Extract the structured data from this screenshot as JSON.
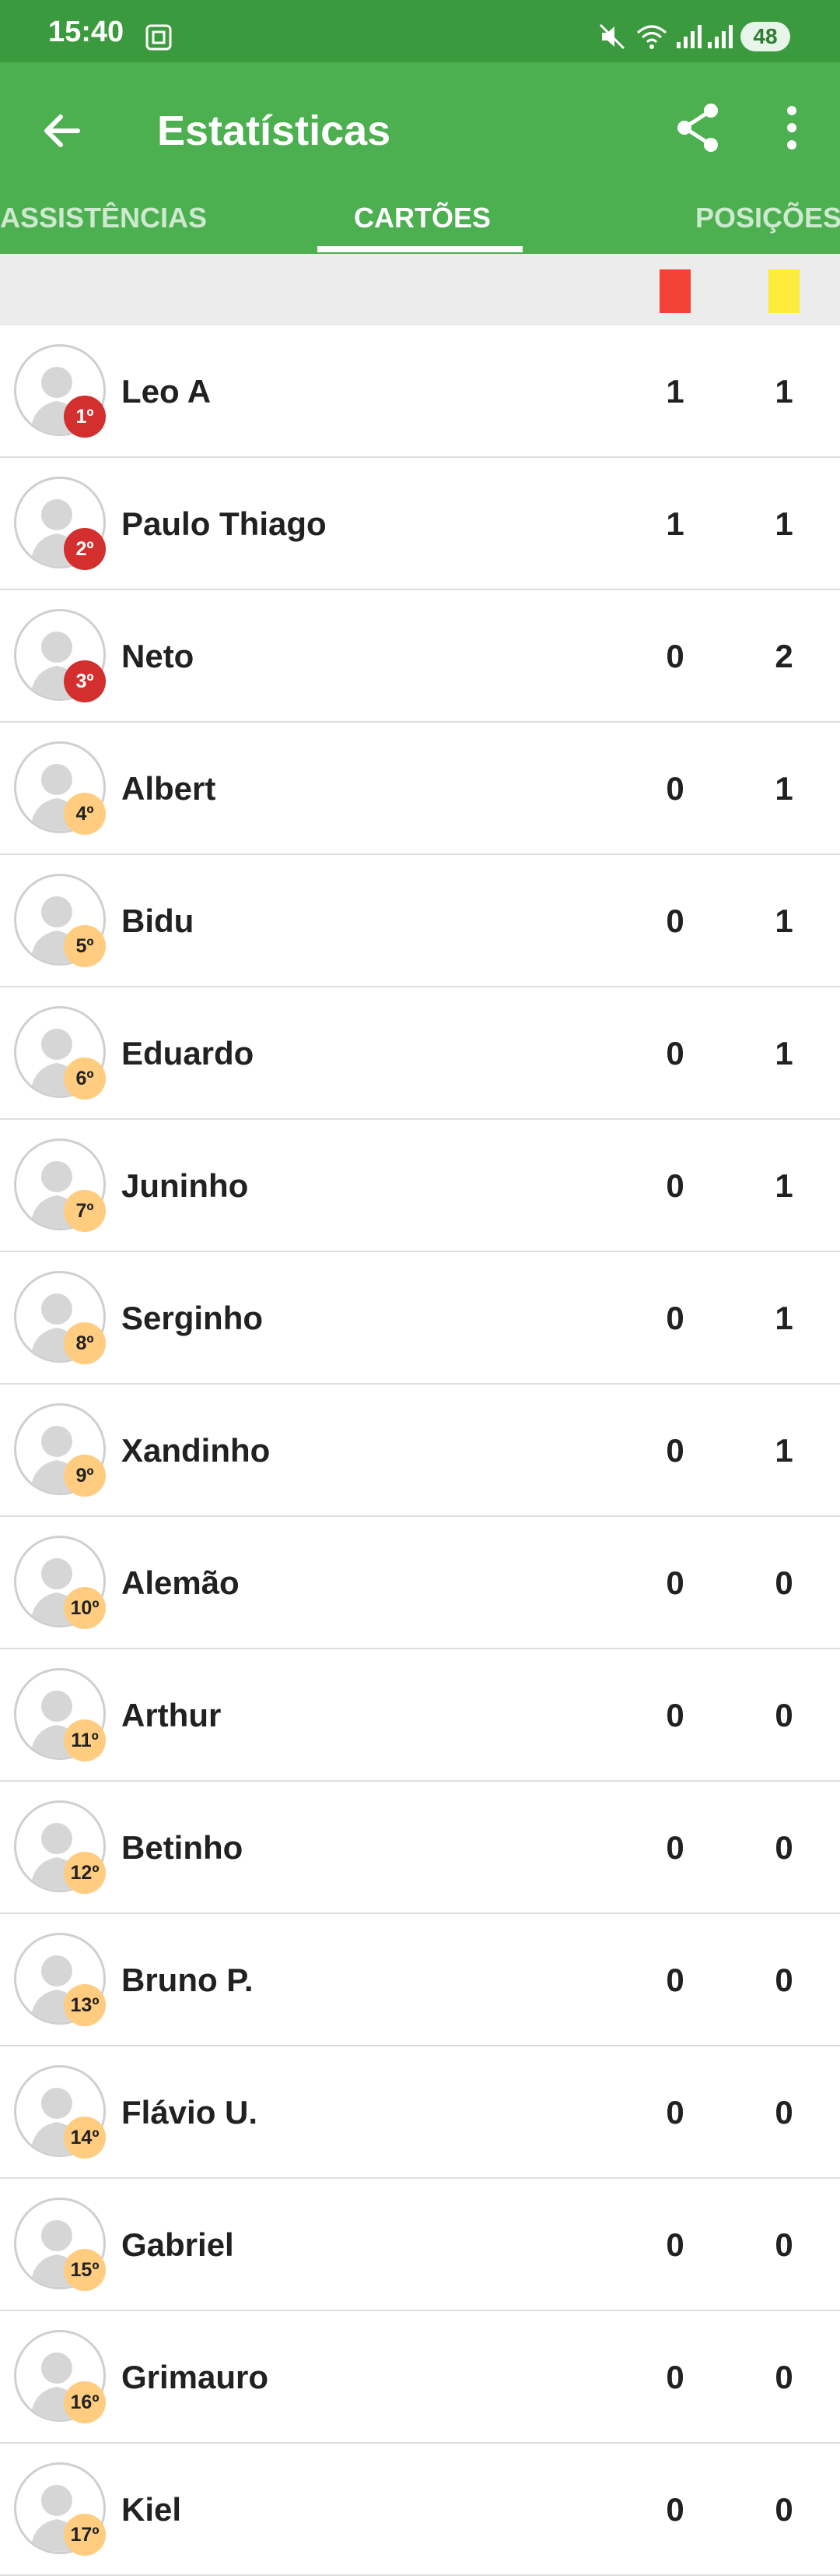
{
  "status_bar": {
    "time": "15:40",
    "battery": "48"
  },
  "app_bar": {
    "title": "Estatísticas"
  },
  "tabs": [
    {
      "label": "ASSISTÊNCIAS",
      "selected": false
    },
    {
      "label": "CARTÕES",
      "selected": true
    },
    {
      "label": "POSIÇÕES",
      "selected": false
    }
  ],
  "colors": {
    "red_card": "#f44336",
    "yellow_card": "#ffeb3b",
    "app_green": "#4caf50",
    "status_green": "#3b9a3e"
  },
  "players": [
    {
      "rank": "1º",
      "name": "Leo A",
      "red": "1",
      "yellow": "1"
    },
    {
      "rank": "2º",
      "name": "Paulo Thiago",
      "red": "1",
      "yellow": "1"
    },
    {
      "rank": "3º",
      "name": "Neto",
      "red": "0",
      "yellow": "2"
    },
    {
      "rank": "4º",
      "name": "Albert",
      "red": "0",
      "yellow": "1"
    },
    {
      "rank": "5º",
      "name": "Bidu",
      "red": "0",
      "yellow": "1"
    },
    {
      "rank": "6º",
      "name": "Eduardo",
      "red": "0",
      "yellow": "1"
    },
    {
      "rank": "7º",
      "name": "Juninho",
      "red": "0",
      "yellow": "1"
    },
    {
      "rank": "8º",
      "name": "Serginho",
      "red": "0",
      "yellow": "1"
    },
    {
      "rank": "9º",
      "name": "Xandinho",
      "red": "0",
      "yellow": "1"
    },
    {
      "rank": "10º",
      "name": "Alemão",
      "red": "0",
      "yellow": "0"
    },
    {
      "rank": "11º",
      "name": "Arthur",
      "red": "0",
      "yellow": "0"
    },
    {
      "rank": "12º",
      "name": "Betinho",
      "red": "0",
      "yellow": "0"
    },
    {
      "rank": "13º",
      "name": "Bruno P.",
      "red": "0",
      "yellow": "0"
    },
    {
      "rank": "14º",
      "name": "Flávio U.",
      "red": "0",
      "yellow": "0"
    },
    {
      "rank": "15º",
      "name": "Gabriel",
      "red": "0",
      "yellow": "0"
    },
    {
      "rank": "16º",
      "name": "Grimauro",
      "red": "0",
      "yellow": "0"
    },
    {
      "rank": "17º",
      "name": "Kiel",
      "red": "0",
      "yellow": "0"
    }
  ]
}
